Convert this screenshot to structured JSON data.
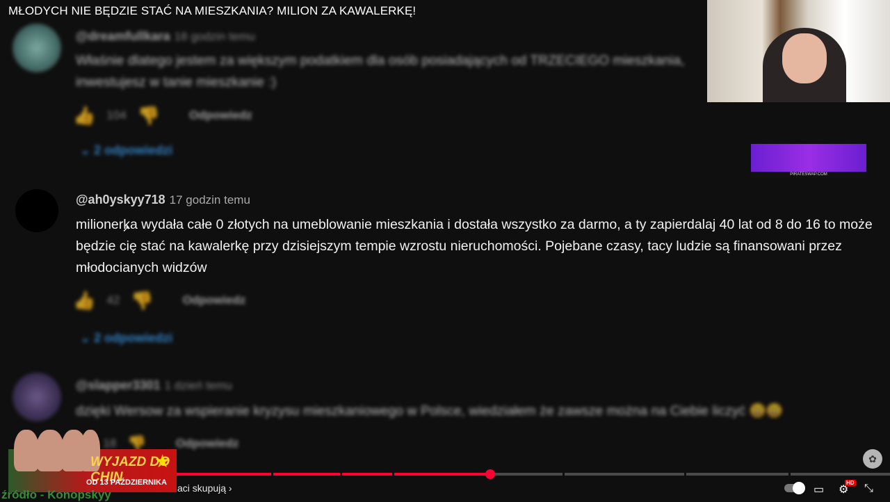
{
  "video_title": "MŁODYCH NIE BĘDZIE STAĆ NA MIESZKANIA? MILION ZA KAWALERKĘ!",
  "comment_top": {
    "author": "@dreamfullkara",
    "time": "18 godzin temu",
    "text": "Właśnie dlatego jestem za większym podatkiem dla osób posiadających od TRZECIEGO mieszkania, inwestujesz w tanie mieszkanie :)",
    "likes": "104",
    "reply_label": "Odpowiedz",
    "replies_label": "2 odpowiedzi"
  },
  "comment_main": {
    "author": "@ah0yskyy718",
    "time": "17 godzin temu",
    "text": "milionerka wydała całe 0 złotych na umeblowanie mieszkania i dostała wszystko za darmo, a ty zapierdalaj 40 lat od 8 do 16 to może będzie cię stać na kawalerkę przy dzisiejszym tempie wzrostu nieruchomości. Pojebane czasy, tacy ludzie są finansowani przez młodocianych widzów",
    "likes": "42",
    "reply_label": "Odpowiedz",
    "replies_label": "2 odpowiedzi"
  },
  "comment_bottom": {
    "author": "@slapper3301",
    "time": "1 dzień temu",
    "text": "dzięki Wersow za wspieranie kryzysu mieszkaniowego w Polsce, wiedziałem że zawsze można na Ciebie liczyć 😃😃",
    "likes": "18",
    "reply_label": "Odpowiedz"
  },
  "overlay": {
    "banner_caption": "PIRATESWAP.COM",
    "promo_title": "WYJAZD DO CHIN",
    "promo_date": "OD 13 PAŹDZIERNIKA",
    "source_label": "źródło - Konopskyy"
  },
  "player": {
    "chapter_label": "aci skupują ›",
    "progress": 0.44,
    "hd_badge": "HD"
  },
  "colors": {
    "background": "#0f0f0f",
    "accent_red": "#ff0033",
    "link_blue": "#3ea6ff"
  }
}
